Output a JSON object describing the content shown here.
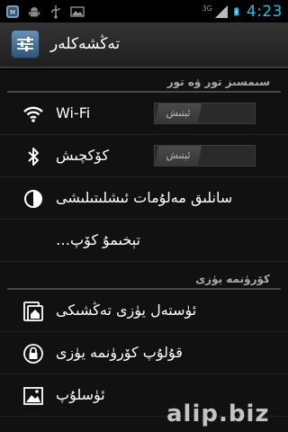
{
  "status_bar": {
    "network_label": "3G",
    "time": "4:23",
    "icons_left": [
      "app-notification-icon",
      "android-icon",
      "usb-icon",
      "image-icon"
    ],
    "icons_right": [
      "signal-icon",
      "battery-charging-icon"
    ]
  },
  "action_bar": {
    "title": "تەڭشەكلەر",
    "app_icon": "settings-sliders-icon"
  },
  "sections": {
    "wireless": {
      "header": "سىمسىز تور ۋە تور",
      "wifi": {
        "label": "Wi-Fi",
        "switch": "ئېتىش",
        "icon": "wifi-icon"
      },
      "bluetooth": {
        "label": "كۆكچىش",
        "switch": "ئېتىش",
        "icon": "bluetooth-icon"
      },
      "data_usage": {
        "label": "سانلىق مەلۇمات ئىشلىتىلىشى",
        "icon": "data-usage-icon"
      },
      "more": {
        "label": "تېخىمۇ كۆپ…"
      }
    },
    "device": {
      "header": "كۆرۈنمە يۈزى",
      "home": {
        "label": "ئۈستەل يۈزى تەڭشىكى",
        "icon": "home-screen-icon"
      },
      "lock": {
        "label": "قۇلۇپ كۆرۈنمە يۈزى",
        "icon": "lock-icon"
      },
      "wallpaper": {
        "label": "ئۈسلۇپ",
        "icon": "wallpaper-icon"
      }
    }
  },
  "watermark": "alip.biz"
}
